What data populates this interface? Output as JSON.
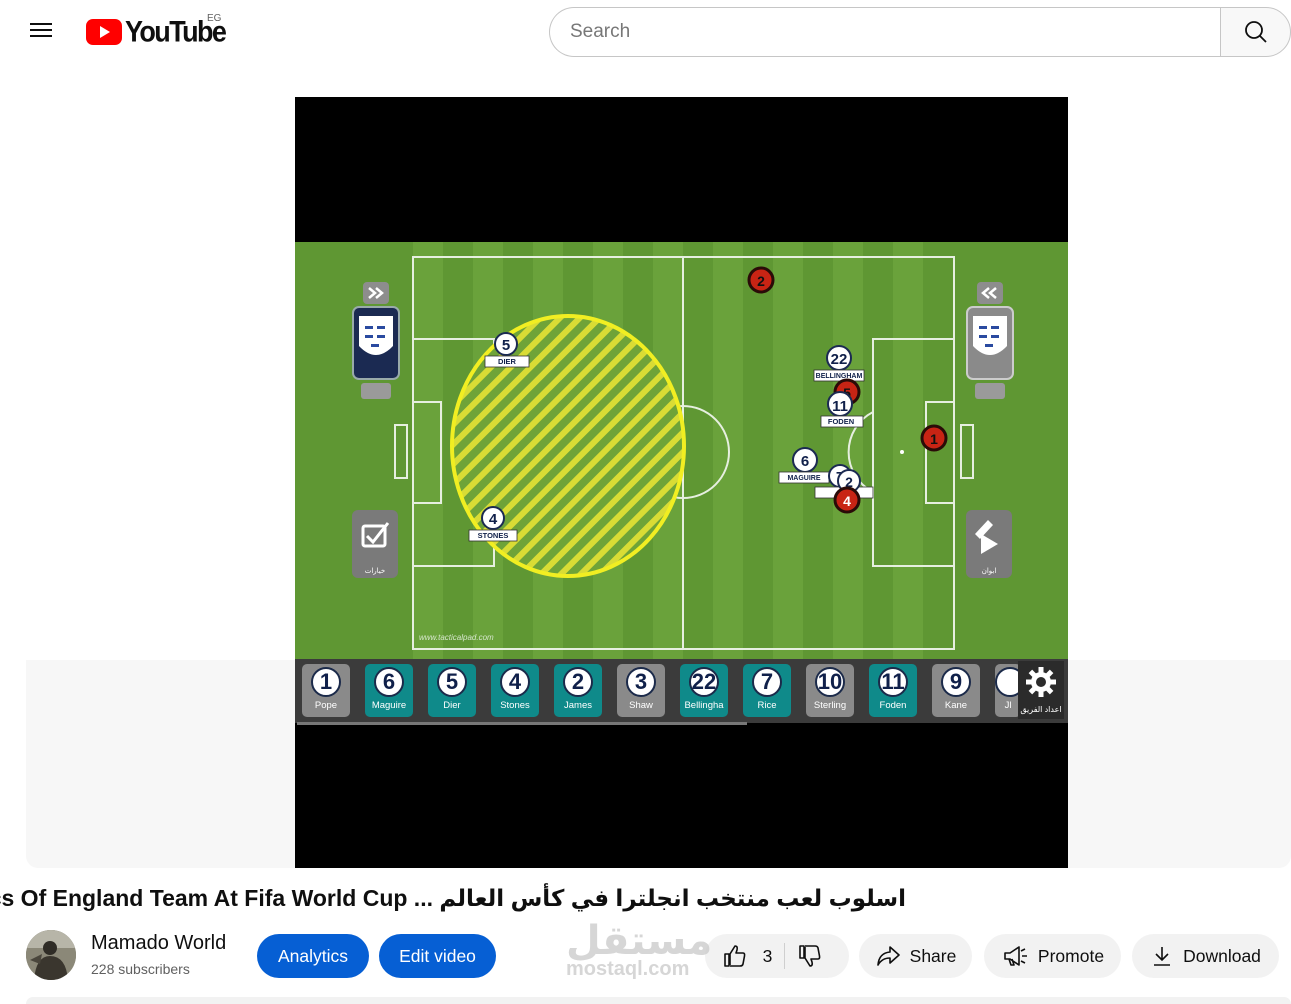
{
  "header": {
    "logo_text": "YouTube",
    "country": "EG",
    "search_placeholder": "Search"
  },
  "video": {
    "title": "اسلوب لعب منتخب انجلترا في كأس العالم ... Tactics Of England Team At Fifa World Cup",
    "tactics_board": {
      "site_text": "www.tacticalpad.com",
      "left_button_caption": "خيارات",
      "right_button_caption": "ابوان",
      "settings_caption": "اعداد الفريق",
      "home_players": [
        {
          "number": "5",
          "name": "DIER"
        },
        {
          "number": "4",
          "name": "STONES"
        },
        {
          "number": "22",
          "name": "BELLINGHAM"
        },
        {
          "number": "11",
          "name": "FODEN"
        },
        {
          "number": "6",
          "name": "MAGUIRE"
        },
        {
          "number": "7",
          "name": ""
        }
      ],
      "opponent_players": [
        "2",
        "5",
        "1",
        "2",
        "4"
      ],
      "bench": [
        {
          "number": "1",
          "name": "Pope",
          "color": "#8a8a8a"
        },
        {
          "number": "6",
          "name": "Maguire",
          "color": "#0f8a8a"
        },
        {
          "number": "5",
          "name": "Dier",
          "color": "#0f8a8a"
        },
        {
          "number": "4",
          "name": "Stones",
          "color": "#0f8a8a"
        },
        {
          "number": "2",
          "name": "James",
          "color": "#0f8a8a"
        },
        {
          "number": "3",
          "name": "Shaw",
          "color": "#8a8a8a"
        },
        {
          "number": "22",
          "name": "Bellingha",
          "color": "#0f8a8a"
        },
        {
          "number": "7",
          "name": "Rice",
          "color": "#0f8a8a"
        },
        {
          "number": "10",
          "name": "Sterling",
          "color": "#8a8a8a"
        },
        {
          "number": "11",
          "name": "Foden",
          "color": "#0f8a8a"
        },
        {
          "number": "9",
          "name": "Kane",
          "color": "#8a8a8a"
        },
        {
          "number": "",
          "name": "Jl",
          "color": "#8a8a8a"
        }
      ]
    }
  },
  "owner": {
    "channel_name": "Mamado World",
    "subscribers": "228 subscribers"
  },
  "actions": {
    "analytics": "Analytics",
    "edit_video": "Edit video",
    "like_count": "3",
    "share": "Share",
    "promote": "Promote",
    "download": "Download"
  },
  "watermark": {
    "arabic": "مستقل",
    "latin": "mostaql.com"
  },
  "colors": {
    "brand_red": "#ff0000",
    "accent_blue": "#065fd4",
    "pitch_green": "#5f9733"
  }
}
